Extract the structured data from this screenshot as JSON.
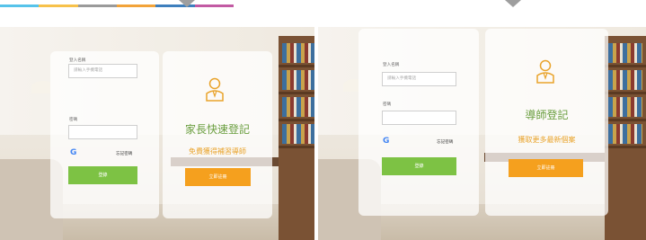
{
  "top_bar_colors": [
    "#56c3ea",
    "#f7c14a",
    "#9a9a9a",
    "#f2a33a",
    "#3e7fbd",
    "#c25aa3"
  ],
  "accent_green": "#7dc244",
  "accent_orange": "#f5a01e",
  "parent_panel": {
    "login": {
      "username_label": "登入名稱",
      "username_placeholder": "請輸入手機電話",
      "password_label": "密碼",
      "forgot_link": "忘記密碼",
      "login_button": "登錄",
      "google_icon": "google-icon"
    },
    "register": {
      "icon": "person-icon",
      "title": "家長快速登記",
      "subtitle": "免費獲得補習導師",
      "button": "立即註冊"
    }
  },
  "tutor_panel": {
    "login": {
      "username_label": "登入名稱",
      "username_placeholder": "請輸入手機電話",
      "password_label": "密碼",
      "forgot_link": "忘記密碼",
      "login_button": "登錄",
      "google_icon": "google-icon"
    },
    "register": {
      "icon": "person-icon",
      "title": "導師登記",
      "subtitle": "獲取更多最新個案",
      "button": "立即註冊"
    }
  }
}
